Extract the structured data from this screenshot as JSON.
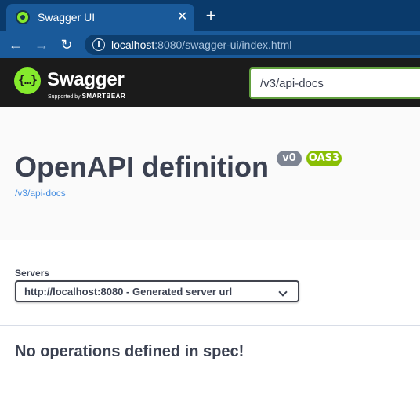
{
  "browser": {
    "tab_title": "Swagger UI",
    "tab_close": "✕",
    "new_tab": "+",
    "back": "←",
    "forward": "→",
    "reload": "↻",
    "url_host": "localhost",
    "url_path": ":8080/swagger-ui/index.html",
    "info_glyph": "i"
  },
  "topbar": {
    "logo_glyph": "{…}",
    "logo_text": "Swagger",
    "logo_sub_prefix": "Supported by ",
    "logo_sub_brand": "SMARTBEAR",
    "spec_url_value": "/v3/api-docs",
    "brand_color": "#85ea2d"
  },
  "info": {
    "title": "OpenAPI definition",
    "version_badge": "v0",
    "oas_badge": "OAS3",
    "spec_link": "/v3/api-docs"
  },
  "servers": {
    "label": "Servers",
    "selected": "http://localhost:8080 - Generated server url"
  },
  "operations": {
    "empty_message": "No operations defined in spec!"
  }
}
